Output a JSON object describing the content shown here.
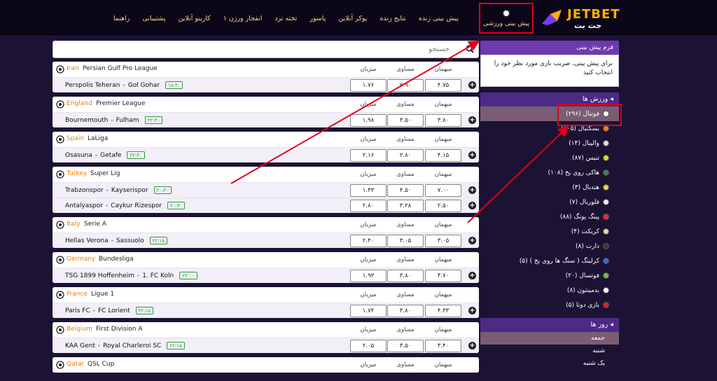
{
  "logo": {
    "en": "JETBET",
    "fa": "جت بت"
  },
  "nav": {
    "active": "پیش بینی ورزشی",
    "items": [
      "پیش بینی زنده",
      "نتایج زنده",
      "پوکر آنلاین",
      "پاسور",
      "تخته نرد",
      "انفجار ورژن ۱",
      "کازینو آنلاین",
      "پشتیبانی",
      "راهنما"
    ]
  },
  "search": {
    "placeholder": "جستجو"
  },
  "odds_headers": {
    "home": "میهمان",
    "draw": "مساوی",
    "away": "میزبان"
  },
  "matches": [
    {
      "country": "Iran",
      "league": "Persian Gulf Pro League",
      "rows": [
        {
          "home": "Perspolis Teheran",
          "away": "Gol Gohar",
          "time": "۱۸:۳۰",
          "o1": "۴.۷۵",
          "o2": "۲.۹۰",
          "o3": "۱.۷۶"
        }
      ]
    },
    {
      "country": "England",
      "league": "Premier League",
      "rows": [
        {
          "home": "Bournemouth",
          "away": "Fulham",
          "time": "۲۲:۳۰",
          "o1": "۳.۸۰",
          "o2": "۳.۵۰",
          "o3": "۱.۹۸"
        }
      ]
    },
    {
      "country": "Spain",
      "league": "LaLiga",
      "rows": [
        {
          "home": "Osasuna",
          "away": "Getafe",
          "time": "۲۲:۳۰",
          "o1": "۴.۱۵",
          "o2": "۲.۸۰",
          "o3": "۲.۱۶"
        }
      ]
    },
    {
      "country": "Turkey",
      "league": "Super Lig",
      "rows": [
        {
          "home": "Trabzonspor",
          "away": "Kayserispor",
          "time": "۲۰:۳۰",
          "o1": "۷.۰۰",
          "o2": "۴.۵۰",
          "o3": "۱.۴۳"
        },
        {
          "home": "Antalyaspor",
          "away": "Caykur Rizespor",
          "time": "۲۰:۳۰",
          "o1": "۲.۵۰",
          "o2": "۳.۲۸",
          "o3": "۲.۸۰"
        }
      ]
    },
    {
      "country": "Italy",
      "league": "Serie A",
      "rows": [
        {
          "home": "Hellas Verona",
          "away": "Sassuolo",
          "time": "۲۲:۱۵",
          "o1": "۳.۰۵",
          "o2": "۳.۰۵",
          "o3": "۲.۴۰"
        }
      ]
    },
    {
      "country": "Germany",
      "league": "Bundesliga",
      "rows": [
        {
          "home": "TSG 1899 Hoffenheim",
          "away": "1. FC Koln",
          "time": "۲۲:۰۰",
          "o1": "۳.۷۰",
          "o2": "۳.۸۰",
          "o3": "۱.۹۳"
        }
      ]
    },
    {
      "country": "France",
      "league": "Ligue 1",
      "rows": [
        {
          "home": "Paris FC",
          "away": "FC Lorient",
          "time": "۲۲:۱۵",
          "o1": "۴.۳۳",
          "o2": "۳.۸۰",
          "o3": "۱.۷۴"
        }
      ]
    },
    {
      "country": "Belgium",
      "league": "First Division A",
      "rows": [
        {
          "home": "KAA Gent",
          "away": "Royal Charleroi SC",
          "time": "۲۲:۱۵",
          "o1": "۳.۴۰",
          "o2": "۳.۵۰",
          "o3": "۲.۰۵"
        }
      ]
    },
    {
      "country": "Qatar",
      "league": "QSL Cup",
      "rows": []
    }
  ],
  "sidebar": {
    "form_title": "فرم پیش بینی",
    "form_text": "برای پیش بینی، ضریب بازی مورد نظر خود را انتخاب کنید",
    "sports_title": "ورزش ها",
    "sports": [
      {
        "label": "فوتبال (۲۹۶)",
        "color": "#ffffff"
      },
      {
        "label": "بسکتبال (۱۰۵)",
        "color": "#f07b1e"
      },
      {
        "label": "والیبال (۱۴)",
        "color": "#dddddd"
      },
      {
        "label": "تنیس (۸۷)",
        "color": "#c8e03a"
      },
      {
        "label": "هاکی روی یخ (۱۰۸)",
        "color": "#4a7d4a"
      },
      {
        "label": "هندبال (۳)",
        "color": "#e8d24a"
      },
      {
        "label": "فلوربال (۷)",
        "color": "#eeeeee"
      },
      {
        "label": "پینگ پونگ (۸۸)",
        "color": "#d8323c"
      },
      {
        "label": "کریکت (۴)",
        "color": "#e8d8a0"
      },
      {
        "label": "دارت (۸)",
        "color": "#3a3a3a"
      },
      {
        "label": "کرلینگ ( سنگ ها روی یخ ) (۵)",
        "color": "#3a6bd8"
      },
      {
        "label": "فوتسال (۲۰)",
        "color": "#7ab82e"
      },
      {
        "label": "بدمینتون (۸)",
        "color": "#ffffff"
      },
      {
        "label": "بازی دوتا (۵)",
        "color": "#d82020"
      }
    ],
    "days_title": "روز ها",
    "days": [
      "جمعه",
      "شنبه",
      "یک شنبه"
    ]
  }
}
